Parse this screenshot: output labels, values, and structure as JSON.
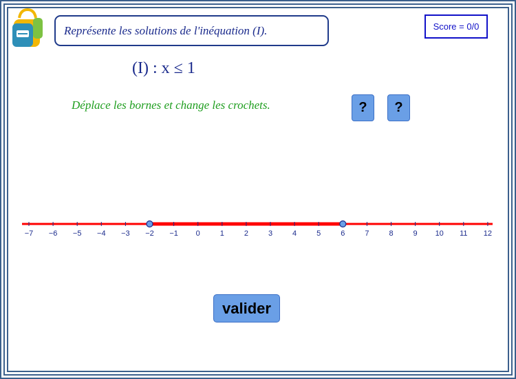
{
  "instruction": "Représente les solutions de l'inéquation (I).",
  "score": "Score = 0/0",
  "inequation": "(I) : x ≤ 1",
  "hint": "Déplace les bornes et change les crochets.",
  "left_bracket_button": "?",
  "right_bracket_button": "?",
  "validate_label": "valider",
  "number_line": {
    "tick_labels": [
      "−7",
      "−6",
      "−5",
      "−4",
      "−3",
      "−2",
      "−1",
      "0",
      "1",
      "2",
      "3",
      "4",
      "5",
      "6",
      "7",
      "8",
      "9",
      "10",
      "11",
      "12"
    ],
    "left_bound": -2,
    "right_bound": 6
  },
  "colors": {
    "accent": "#6a9fe6",
    "frame": "#3b5f8c",
    "axis_red": "#ff0000",
    "text_blue": "#1a2a8c",
    "hint_green": "#1f9e1f"
  }
}
